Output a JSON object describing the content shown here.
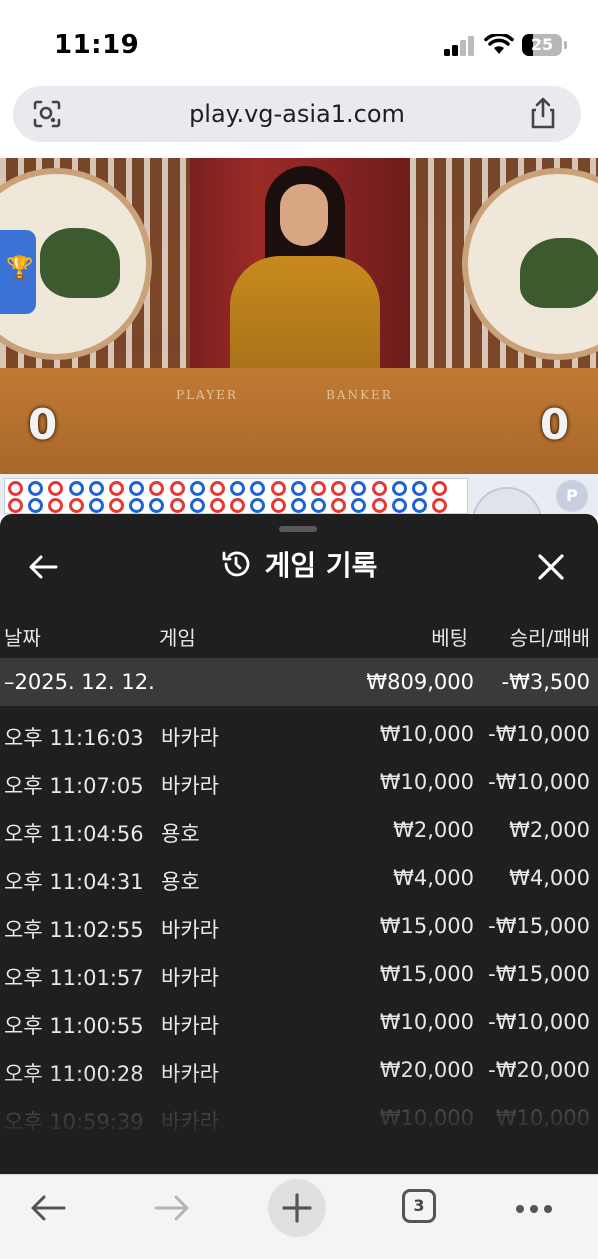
{
  "status_bar": {
    "time": "11:19",
    "battery": "25"
  },
  "browser": {
    "url": "play.vg-asia1.com",
    "tab_count": "3"
  },
  "video": {
    "table_labels": [
      "PLAYER",
      "BANKER"
    ],
    "player_score": "0",
    "banker_score": "0"
  },
  "sheet": {
    "title": "게임 기록",
    "columns": {
      "date": "날짜",
      "game": "게임",
      "bet": "베팅",
      "result": "승리/패배"
    },
    "summary": {
      "date": "–2025. 12. 12.",
      "bet": "₩809,000",
      "result": "-₩3,500"
    },
    "rows": [
      {
        "time": "오후 11:16:03",
        "game": "바카라",
        "bet": "₩10,000",
        "result": "-₩10,000"
      },
      {
        "time": "오후 11:07:05",
        "game": "바카라",
        "bet": "₩10,000",
        "result": "-₩10,000"
      },
      {
        "time": "오후 11:04:56",
        "game": "용호",
        "bet": "₩2,000",
        "result": "₩2,000"
      },
      {
        "time": "오후 11:04:31",
        "game": "용호",
        "bet": "₩4,000",
        "result": "₩4,000"
      },
      {
        "time": "오후 11:02:55",
        "game": "바카라",
        "bet": "₩15,000",
        "result": "-₩15,000"
      },
      {
        "time": "오후 11:01:57",
        "game": "바카라",
        "bet": "₩15,000",
        "result": "-₩15,000"
      },
      {
        "time": "오후 11:00:55",
        "game": "바카라",
        "bet": "₩10,000",
        "result": "-₩10,000"
      },
      {
        "time": "오후 11:00:28",
        "game": "바카라",
        "bet": "₩20,000",
        "result": "-₩20,000"
      },
      {
        "time": "오후 10:59:39",
        "game": "바카라",
        "bet": "₩10,000",
        "result": "₩10,000"
      }
    ]
  },
  "icons": {
    "back": "arrow-left-icon",
    "history": "history-icon",
    "close": "close-icon",
    "lens": "lens-icon",
    "share": "share-icon",
    "trophy": "trophy-icon"
  },
  "colors": {
    "sheet_bg": "#1f1f1f",
    "summary_bg": "#3a3a3a",
    "banker_red": "#e53935",
    "player_blue": "#1e63d6"
  }
}
